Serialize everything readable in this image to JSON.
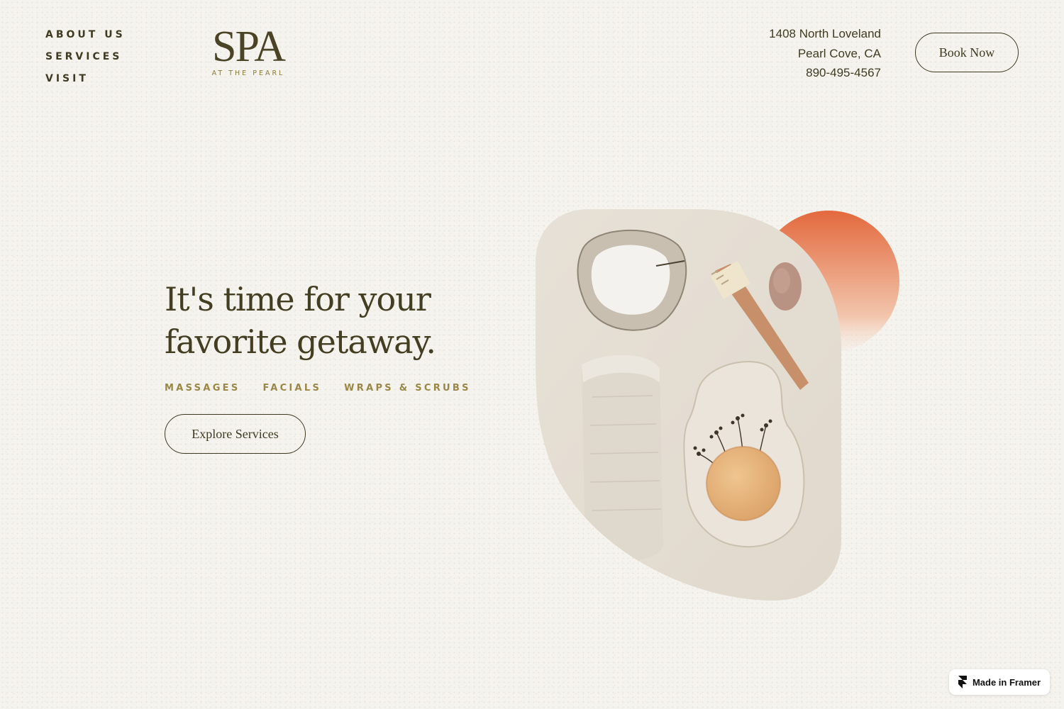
{
  "nav": {
    "items": [
      {
        "label": "ABOUT US"
      },
      {
        "label": "SERVICES"
      },
      {
        "label": "VISIT"
      }
    ]
  },
  "logo": {
    "main": "SPA",
    "sub": "AT THE PEARL"
  },
  "contact": {
    "address_line1": "1408 North Loveland",
    "address_line2": "Pearl Cove, CA",
    "phone": "890-495-4567"
  },
  "header": {
    "book_label": "Book Now"
  },
  "hero": {
    "title_line1": "It's time for your",
    "title_line2": "favorite getaway.",
    "categories": [
      "MASSAGES",
      "FACIALS",
      "WRAPS & SCRUBS"
    ],
    "explore_label": "Explore Services"
  },
  "badge": {
    "label": "Made in Framer",
    "icon": "framer-icon"
  },
  "colors": {
    "background": "#f5f3ee",
    "text": "#3f3a22",
    "accent": "#9a8746",
    "sun": "#e57a4f"
  }
}
